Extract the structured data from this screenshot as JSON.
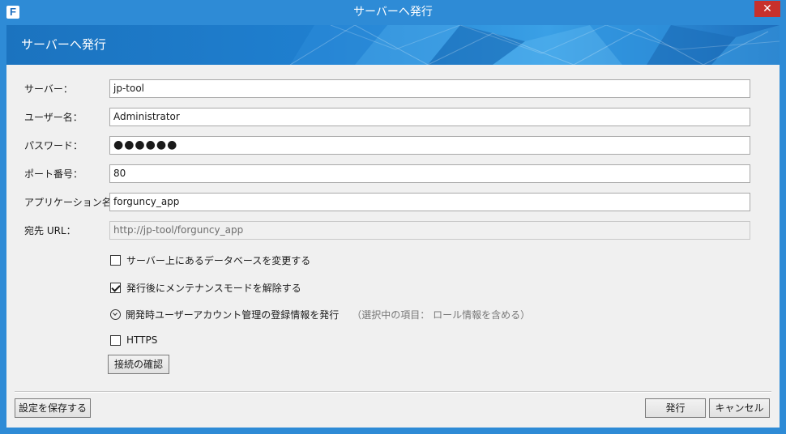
{
  "window": {
    "app_icon_letter": "F",
    "title": "サーバーへ発行",
    "close_glyph": "✕"
  },
  "banner": {
    "title": "サーバーへ発行"
  },
  "form": {
    "server": {
      "label": "サーバー：",
      "value": "jp-tool"
    },
    "username": {
      "label": "ユーザー名：",
      "value": "Administrator"
    },
    "password": {
      "label": "パスワード：",
      "value": "●●●●●●"
    },
    "port": {
      "label": "ポート番号：",
      "value": "80"
    },
    "app_name": {
      "label": "アプリケーション名：",
      "value": "forguncy_app"
    },
    "url": {
      "label": "宛先 URL：",
      "value": "http://jp-tool/forguncy_app"
    }
  },
  "options": {
    "change_db": {
      "label": "サーバー上にあるデータベースを変更する",
      "checked": false
    },
    "release_maintenance": {
      "label": "発行後にメンテナンスモードを解除する",
      "checked": true
    },
    "publish_accounts": {
      "label": "開発時ユーザーアカウント管理の登録情報を発行",
      "hint": "（選択中の項目： ロール情報を含める）",
      "icon": "chevron-circle-down-icon"
    },
    "https": {
      "label": "HTTPS",
      "checked": false
    }
  },
  "buttons": {
    "test_connection": "接続の確認",
    "save_settings": "設定を保存する",
    "publish": "発行",
    "cancel": "キャンセル"
  }
}
